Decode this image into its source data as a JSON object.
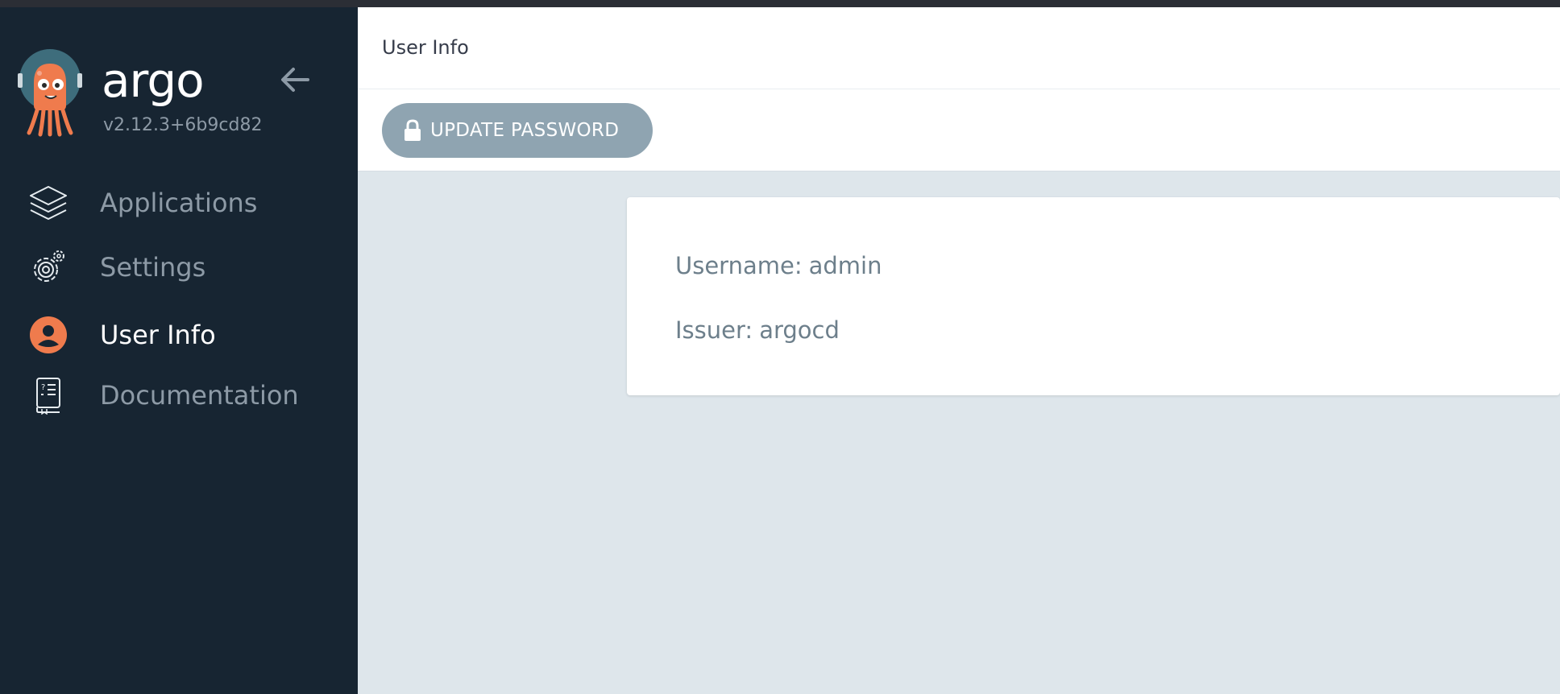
{
  "app": {
    "brand_name": "argo",
    "version": "v2.12.3+6b9cd82"
  },
  "sidebar": {
    "items": [
      {
        "label": "Applications",
        "icon": "layers-icon",
        "active": false
      },
      {
        "label": "Settings",
        "icon": "gear-icon",
        "active": false
      },
      {
        "label": "User Info",
        "icon": "user-icon",
        "active": true
      },
      {
        "label": "Documentation",
        "icon": "book-icon",
        "active": false
      }
    ]
  },
  "header": {
    "title": "User Info"
  },
  "toolbar": {
    "update_password_label": "UPDATE PASSWORD"
  },
  "user_info": {
    "username_label": "Username:",
    "username_value": "admin",
    "issuer_label": "Issuer:",
    "issuer_value": "argocd"
  },
  "colors": {
    "sidebar_bg": "#172532",
    "accent": "#ef7b4d",
    "button_bg": "#8fa4b1",
    "content_bg": "#dee6eb"
  }
}
